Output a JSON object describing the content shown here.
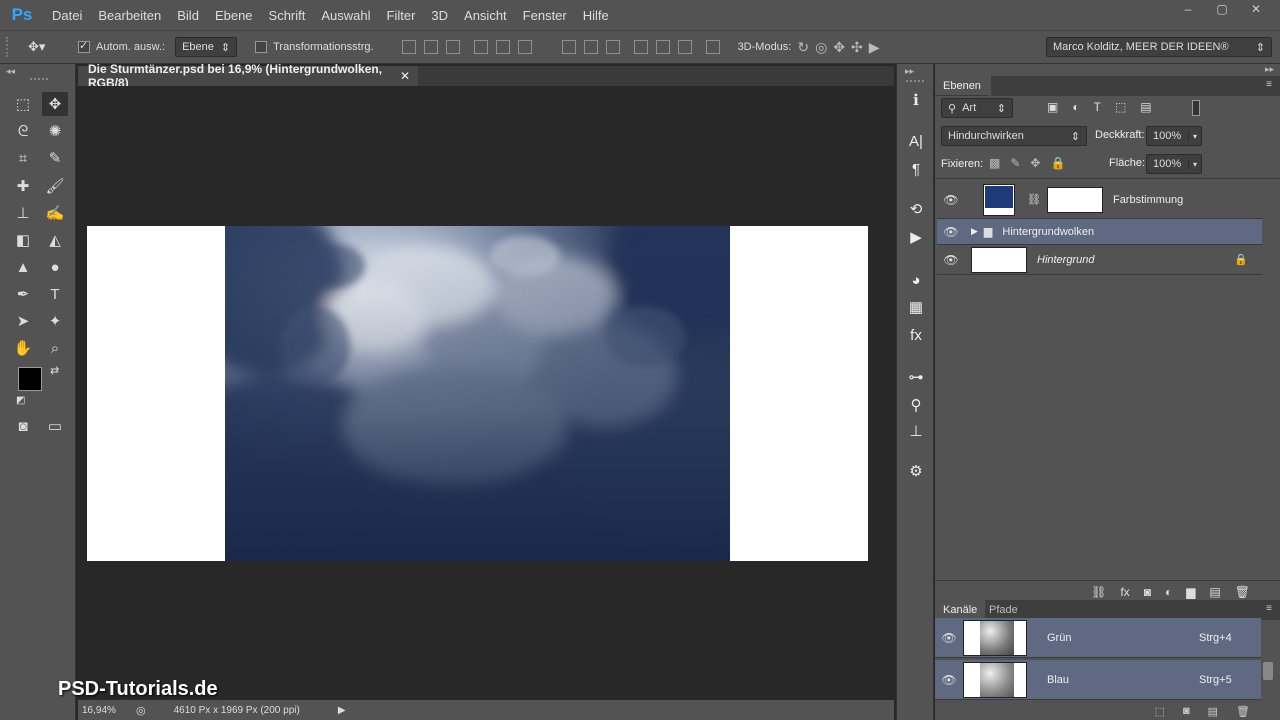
{
  "app": {
    "logo": "Ps"
  },
  "menu": [
    "Datei",
    "Bearbeiten",
    "Bild",
    "Ebene",
    "Schrift",
    "Auswahl",
    "Filter",
    "3D",
    "Ansicht",
    "Fenster",
    "Hilfe"
  ],
  "window_controls": {
    "minimize": "–",
    "restore": "▢",
    "close": "✕"
  },
  "options": {
    "auto_select_label": "Autom. ausw.:",
    "auto_select_value": "Ebene",
    "transform_label": "Transformationsstrg.",
    "mode3d_label": "3D-Modus:",
    "workspace": "Marco Kolditz, MEER DER IDEEN®"
  },
  "document": {
    "tab_title": "Die Sturmtänzer.psd bei 16,9% (Hintergrundwolken, RGB/8)",
    "zoom": "16,94%",
    "info": "4610 Px x 1969 Px (200 ppi)"
  },
  "watermark": "PSD-Tutorials.de",
  "layers_panel": {
    "tab": "Ebenen",
    "filter": "Art",
    "blend_mode": "Hindurchwirken",
    "opacity_label": "Deckkraft:",
    "opacity_value": "100%",
    "lock_label": "Fixieren:",
    "fill_label": "Fläche:",
    "fill_value": "100%",
    "layers": [
      {
        "name": "Farbstimmung"
      },
      {
        "name": "Hintergrundwolken"
      },
      {
        "name": "Hintergrund"
      }
    ]
  },
  "channels_panel": {
    "tabs": [
      "Kanäle",
      "Pfade"
    ],
    "channels": [
      {
        "name": "Grün",
        "shortcut": "Strg+4"
      },
      {
        "name": "Blau",
        "shortcut": "Strg+5"
      }
    ]
  },
  "colors": {
    "fill_swatch": "#1f3a78",
    "selected_row": "#5f6a82",
    "foreground": "#000000",
    "background": "#ffffff"
  }
}
